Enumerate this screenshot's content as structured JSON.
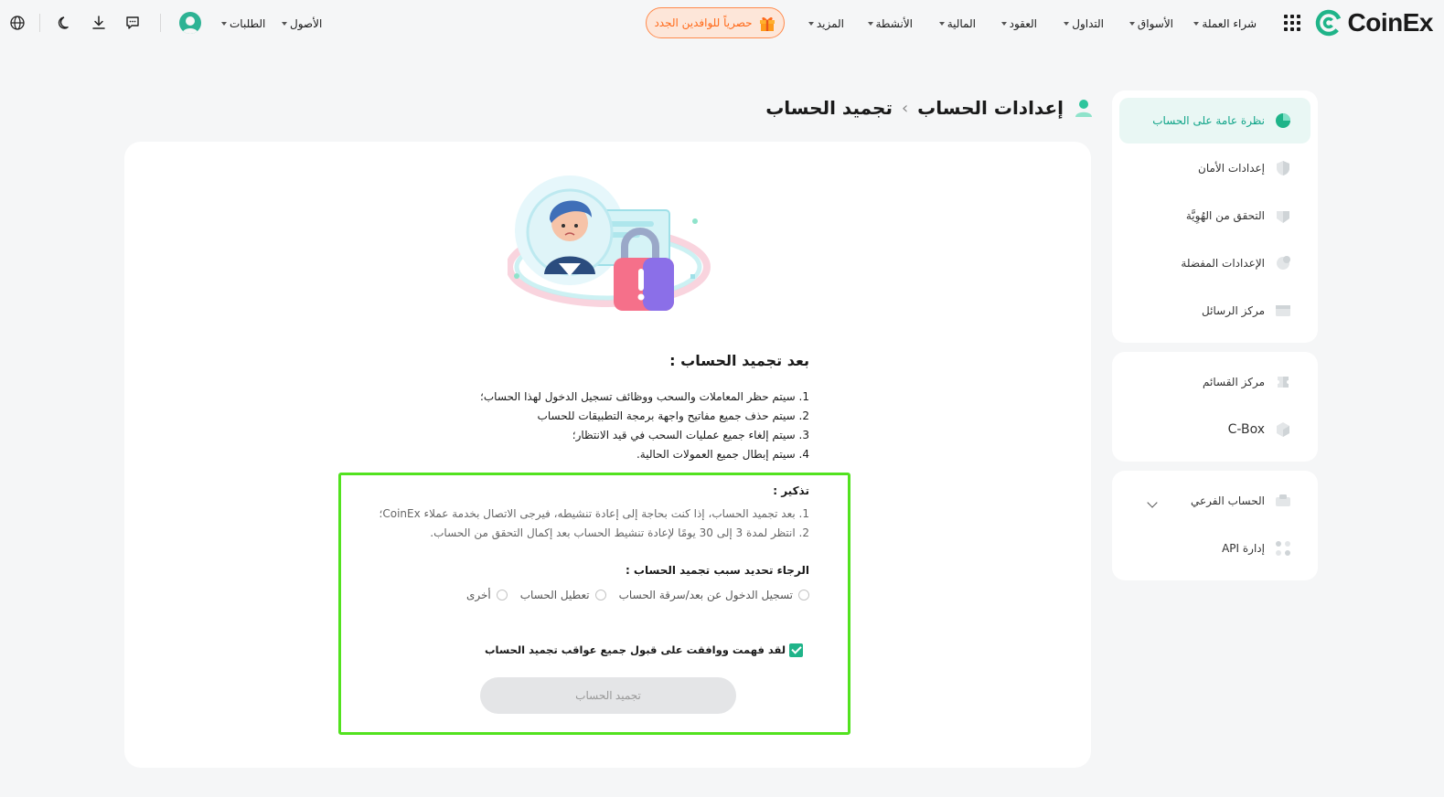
{
  "brand": {
    "name": "CoinEx",
    "accent": "#1fb489"
  },
  "nav": {
    "items": [
      {
        "label": "شراء العملة",
        "dropdown": true
      },
      {
        "label": "الأسواق",
        "dropdown": true
      },
      {
        "label": "التداول",
        "dropdown": true
      },
      {
        "label": "العقود",
        "dropdown": true
      },
      {
        "label": "المالية",
        "dropdown": true
      },
      {
        "label": "الأنشطة",
        "dropdown": true
      },
      {
        "label": "المزيد",
        "dropdown": true
      }
    ],
    "promo": "حصرياً للوافدين الجدد",
    "assets": "الأصول",
    "orders": "الطلبات"
  },
  "sidebar": {
    "group1": [
      {
        "label": "نظرة عامة على الحساب",
        "icon": "overview-icon",
        "active": true
      },
      {
        "label": "إعدادات الأمان",
        "icon": "shield-icon",
        "active": false
      },
      {
        "label": "التحقق من الهُوِيَّة",
        "icon": "identity-icon",
        "active": false
      },
      {
        "label": "الإعدادات المفضلة",
        "icon": "preferences-icon",
        "active": false
      },
      {
        "label": "مركز الرسائل",
        "icon": "message-icon",
        "active": false
      }
    ],
    "group2": [
      {
        "label": "مركز القسائم",
        "icon": "coupon-icon"
      },
      {
        "label": "C-Box",
        "icon": "cbox-icon"
      }
    ],
    "group3": [
      {
        "label": "الحساب الفرعي",
        "icon": "subaccount-icon",
        "expandable": true
      },
      {
        "label": "إدارة API",
        "icon": "api-icon"
      }
    ]
  },
  "breadcrumb": {
    "parent": "إعدادات الحساب",
    "separator": "›",
    "current": "تجميد الحساب"
  },
  "content": {
    "after_title": "بعد تجميد الحساب  :",
    "rules": [
      "1. سيتم حظر المعاملات والسحب ووظائف تسجيل الدخول لهذا الحساب؛",
      "2. سيتم حذف جميع مفاتيح واجهة برمجة التطبيقات للحساب",
      "3. سيتم إلغاء جميع عمليات السحب في قيد الانتظار؛",
      "4. سيتم إبطال جميع العمولات الحالية."
    ],
    "reminder_title": "تذكير  :",
    "reminders": [
      "1. بعد تجميد الحساب، إذا كنت بحاجة إلى إعادة تنشيطه، فيرجى الاتصال بخدمة عملاء CoinEx؛",
      "2. انتظر لمدة 3 إلى 30 يومًا لإعادة تنشيط الحساب بعد إكمال التحقق من الحساب."
    ],
    "reason_title": "الرجاء تحديد سبب تجميد الحساب  :",
    "reasons": [
      "تسجيل الدخول عن بعد/سرقة الحساب",
      "تعطيل الحساب",
      "أخرى"
    ],
    "agree_text": "لقد فهمت ووافقت على قبول جميع عواقب تجميد الحساب",
    "agree_checked": true,
    "submit_label": "تجميد الحساب"
  }
}
